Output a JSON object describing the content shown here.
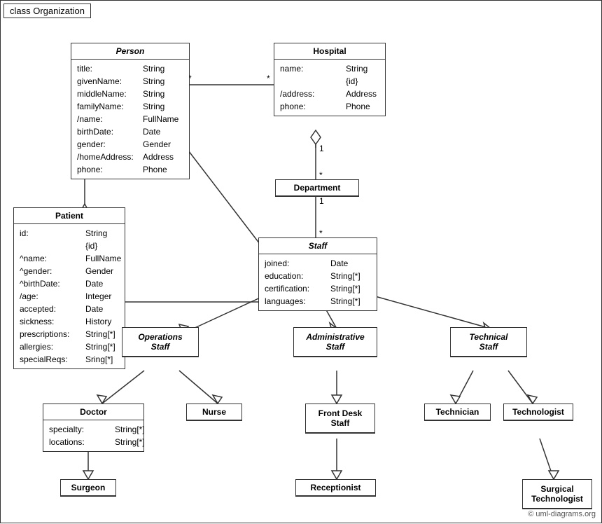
{
  "diagram": {
    "title": "class Organization",
    "copyright": "© uml-diagrams.org",
    "classes": {
      "person": {
        "name": "Person",
        "italic": true,
        "attrs": [
          {
            "name": "title:",
            "type": "String"
          },
          {
            "name": "givenName:",
            "type": "String"
          },
          {
            "name": "middleName:",
            "type": "String"
          },
          {
            "name": "familyName:",
            "type": "String"
          },
          {
            "name": "/name:",
            "type": "FullName"
          },
          {
            "name": "birthDate:",
            "type": "Date"
          },
          {
            "name": "gender:",
            "type": "Gender"
          },
          {
            "name": "/homeAddress:",
            "type": "Address"
          },
          {
            "name": "phone:",
            "type": "Phone"
          }
        ]
      },
      "hospital": {
        "name": "Hospital",
        "italic": false,
        "attrs": [
          {
            "name": "name:",
            "type": "String {id}"
          },
          {
            "name": "/address:",
            "type": "Address"
          },
          {
            "name": "phone:",
            "type": "Phone"
          }
        ]
      },
      "patient": {
        "name": "Patient",
        "italic": false,
        "attrs": [
          {
            "name": "id:",
            "type": "String {id}"
          },
          {
            "name": "^name:",
            "type": "FullName"
          },
          {
            "name": "^gender:",
            "type": "Gender"
          },
          {
            "name": "^birthDate:",
            "type": "Date"
          },
          {
            "name": "/age:",
            "type": "Integer"
          },
          {
            "name": "accepted:",
            "type": "Date"
          },
          {
            "name": "sickness:",
            "type": "History"
          },
          {
            "name": "prescriptions:",
            "type": "String[*]"
          },
          {
            "name": "allergies:",
            "type": "String[*]"
          },
          {
            "name": "specialReqs:",
            "type": "Sring[*]"
          }
        ]
      },
      "department": {
        "name": "Department",
        "italic": false,
        "attrs": []
      },
      "staff": {
        "name": "Staff",
        "italic": true,
        "attrs": [
          {
            "name": "joined:",
            "type": "Date"
          },
          {
            "name": "education:",
            "type": "String[*]"
          },
          {
            "name": "certification:",
            "type": "String[*]"
          },
          {
            "name": "languages:",
            "type": "String[*]"
          }
        ]
      },
      "operations_staff": {
        "name": "Operations\nStaff",
        "italic": true,
        "attrs": []
      },
      "administrative_staff": {
        "name": "Administrative\nStaff",
        "italic": true,
        "attrs": []
      },
      "technical_staff": {
        "name": "Technical\nStaff",
        "italic": true,
        "attrs": []
      },
      "doctor": {
        "name": "Doctor",
        "italic": false,
        "attrs": [
          {
            "name": "specialty:",
            "type": "String[*]"
          },
          {
            "name": "locations:",
            "type": "String[*]"
          }
        ]
      },
      "nurse": {
        "name": "Nurse",
        "italic": false,
        "attrs": []
      },
      "front_desk_staff": {
        "name": "Front Desk\nStaff",
        "italic": false,
        "attrs": []
      },
      "technician": {
        "name": "Technician",
        "italic": false,
        "attrs": []
      },
      "technologist": {
        "name": "Technologist",
        "italic": false,
        "attrs": []
      },
      "surgeon": {
        "name": "Surgeon",
        "italic": false,
        "attrs": []
      },
      "receptionist": {
        "name": "Receptionist",
        "italic": false,
        "attrs": []
      },
      "surgical_technologist": {
        "name": "Surgical\nTechnologist",
        "italic": false,
        "attrs": []
      }
    }
  }
}
